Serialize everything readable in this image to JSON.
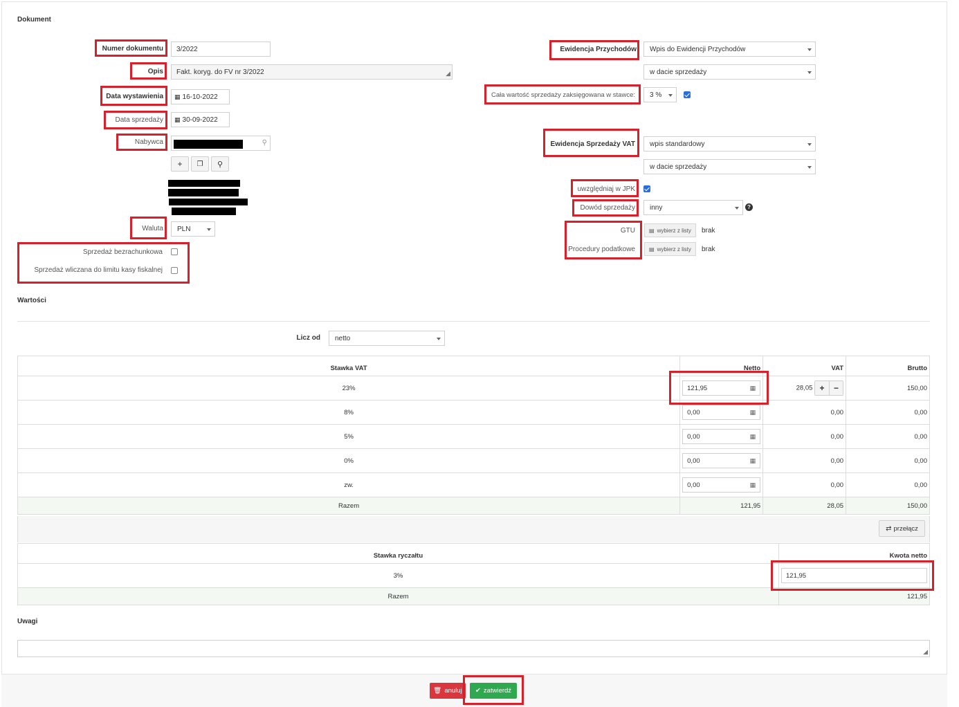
{
  "sections": {
    "document": "Dokument",
    "values": "Wartości",
    "notes": "Uwagi"
  },
  "document": {
    "numer_label": "Numer dokumentu",
    "numer_value": "3/2022",
    "opis_label": "Opis",
    "opis_value": "Fakt. koryg. do FV nr 3/2022",
    "data_wystawienia_label": "Data wystawienia",
    "data_wystawienia_value": "16-10-2022",
    "data_sprzedazy_label": "Data sprzedaży",
    "data_sprzedazy_value": "30-09-2022",
    "nabywca_label": "Nabywca",
    "waluta_label": "Waluta",
    "waluta_value": "PLN",
    "bezrachunkowa_label": "Sprzedaż bezrachunkowa",
    "limit_kasy_label": "Sprzedaż wliczana do limitu kasy fiskalnej"
  },
  "right_panel": {
    "ewidencja_przychodow_label": "Ewidencja Przychodów",
    "ewidencja_przychodow_value": "Wpis do Ewidencji Przychodów",
    "przychody_data_value": "w dacie sprzedaży",
    "cala_wartosc_label": "Cała wartość sprzedaży zaksięgowana w stawce:",
    "stawka_value": "3 %",
    "ewidencja_vat_label": "Ewidencja Sprzedaży VAT",
    "ewidencja_vat_value": "wpis standardowy",
    "vat_data_value": "w dacie sprzedaży",
    "jpk_label": "uwzględniaj w JPK",
    "dowod_label": "Dowód sprzedaży",
    "dowod_value": "inny",
    "gtu_label": "GTU",
    "procedury_label": "Procedury podatkowe",
    "wybierz_label": "wybierz z listy",
    "brak": "brak"
  },
  "values": {
    "licz_od_label": "Licz od",
    "licz_od_value": "netto",
    "headers": [
      "Stawka VAT",
      "Netto",
      "VAT",
      "Brutto"
    ],
    "rows": [
      {
        "stawka": "23%",
        "netto": "121,95",
        "vat": "28,05",
        "brutto": "150,00"
      },
      {
        "stawka": "8%",
        "netto": "0,00",
        "vat": "0,00",
        "brutto": "0,00"
      },
      {
        "stawka": "5%",
        "netto": "0,00",
        "vat": "0,00",
        "brutto": "0,00"
      },
      {
        "stawka": "0%",
        "netto": "0,00",
        "vat": "0,00",
        "brutto": "0,00"
      },
      {
        "stawka": "zw.",
        "netto": "0,00",
        "vat": "0,00",
        "brutto": "0,00"
      }
    ],
    "total": {
      "label": "Razem",
      "netto": "121,95",
      "vat": "28,05",
      "brutto": "150,00"
    },
    "przelacz_label": "przełącz",
    "ryczalt_headers": [
      "Stawka ryczałtu",
      "Kwota netto"
    ],
    "ryczalt_row": {
      "stawka": "3%",
      "kwota": "121,95"
    },
    "ryczalt_total": {
      "label": "Razem",
      "kwota": "121,95"
    }
  },
  "footer": {
    "anuluj": "anuluj",
    "zatwierdz": "zatwierdź"
  },
  "colors": {
    "highlight": "#d9202a",
    "confirm": "#2fa84f",
    "cancel": "#d9363e",
    "checkbox": "#2a6edb"
  }
}
